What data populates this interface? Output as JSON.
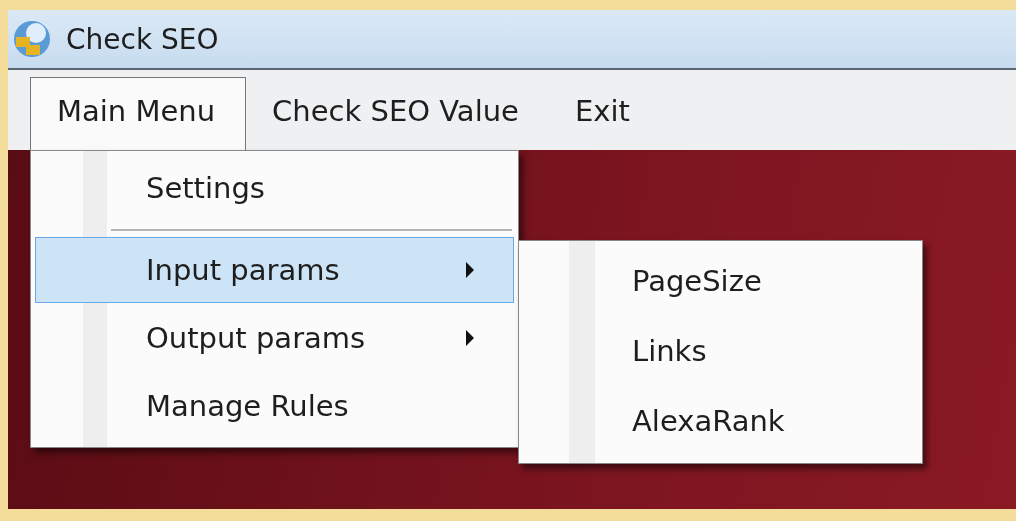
{
  "window": {
    "title": "Check SEO"
  },
  "menu_bar": [
    {
      "label": "Main Menu",
      "selected": true
    },
    {
      "label": "Check SEO Value",
      "selected": false
    },
    {
      "label": "Exit",
      "selected": false
    }
  ],
  "dropdown": {
    "items": [
      {
        "kind": "item",
        "label": "Settings",
        "selected": false,
        "submenu": false
      },
      {
        "kind": "separator"
      },
      {
        "kind": "item",
        "label": "Input params",
        "selected": true,
        "submenu": true
      },
      {
        "kind": "item",
        "label": "Output params",
        "selected": false,
        "submenu": true
      },
      {
        "kind": "item",
        "label": "Manage Rules",
        "selected": false,
        "submenu": false
      }
    ]
  },
  "submenu": {
    "items": [
      {
        "label": "PageSize",
        "selected": false
      },
      {
        "label": "Links",
        "selected": false
      },
      {
        "label": "AlexaRank",
        "selected": false
      }
    ]
  }
}
